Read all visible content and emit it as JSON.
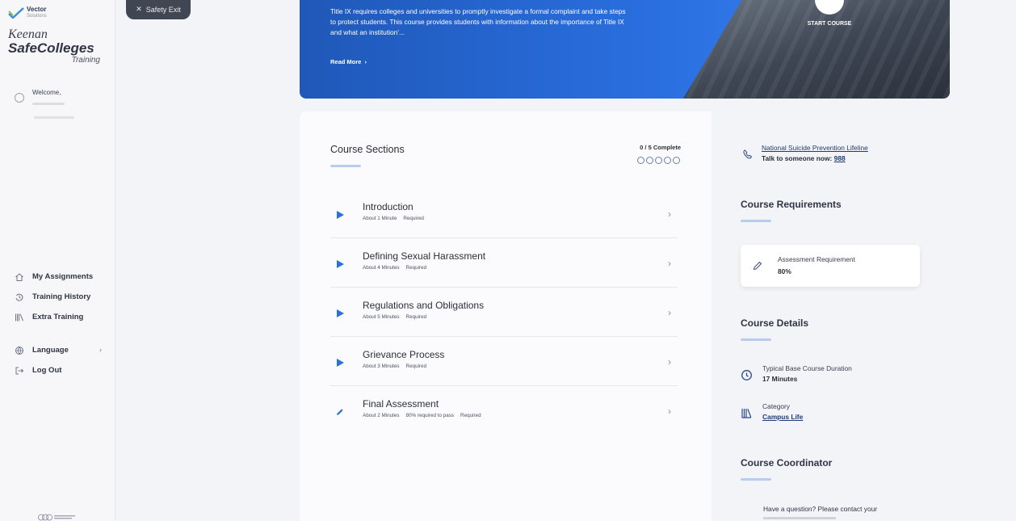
{
  "brand": {
    "vector": "Vector",
    "vector_sub": "Solutions",
    "keenan": "Keenan",
    "safecolleges": "SafeColleges",
    "training": "Training"
  },
  "sidebar": {
    "welcome": "Welcome,",
    "items": [
      {
        "label": "My Assignments",
        "icon": "home-icon"
      },
      {
        "label": "Training History",
        "icon": "history-icon"
      },
      {
        "label": "Extra Training",
        "icon": "library-icon"
      }
    ],
    "language": "Language",
    "logout": "Log Out"
  },
  "safety_exit": "Safety Exit",
  "hero": {
    "description": "Title IX requires colleges and universities to promptly investigate a formal complaint and take steps to protect students. This course provides students with information about the importance of Title IX and what an institution'...",
    "read_more": "Read More",
    "start_course": "START COURSE"
  },
  "course_sections": {
    "title": "Course Sections",
    "progress": "0 / 5 Complete",
    "total_dots": 5,
    "sections": [
      {
        "title": "Introduction",
        "duration": "About 1 Minute",
        "extra": "",
        "required": "Required",
        "icon": "play-icon"
      },
      {
        "title": "Defining Sexual Harassment",
        "duration": "About 4 Minutes",
        "extra": "",
        "required": "Required",
        "icon": "play-icon"
      },
      {
        "title": "Regulations and Obligations",
        "duration": "About 5 Minutes",
        "extra": "",
        "required": "Required",
        "icon": "play-icon"
      },
      {
        "title": "Grievance Process",
        "duration": "About 3 Minutes",
        "extra": "",
        "required": "Required",
        "icon": "play-icon"
      },
      {
        "title": "Final Assessment",
        "duration": "About 2 Minutes",
        "extra": "80% required to pass",
        "required": "Required",
        "icon": "pencil-icon"
      }
    ]
  },
  "right": {
    "lifeline_link": "National Suicide Prevention Lifeline",
    "lifeline_sub": "Talk to someone now:",
    "lifeline_number": "988",
    "requirements_title": "Course Requirements",
    "req_label": "Assessment Requirement",
    "req_value": "80%",
    "details_title": "Course Details",
    "duration_label": "Typical Base Course Duration",
    "duration_value": "17 Minutes",
    "category_label": "Category",
    "category_value": "Campus Life",
    "coordinator_title": "Course Coordinator",
    "coordinator_text": "Have a question? Please contact your"
  },
  "colors": {
    "hero_blue": "#2a6fe0",
    "play_blue": "#2b6fe0",
    "link_blue": "#1d3b78",
    "accent_line": "#b9cdea"
  }
}
